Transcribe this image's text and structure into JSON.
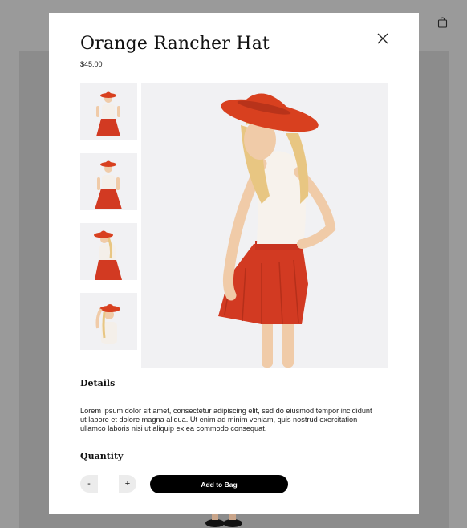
{
  "product": {
    "title": "Orange Rancher Hat",
    "price": "$45.00"
  },
  "icons": {
    "close": "close-icon",
    "bag": "shopping-bag-icon"
  },
  "gallery": {
    "thumbnails": [
      {
        "pose": "standing-hand-on-hip"
      },
      {
        "pose": "standing-front"
      },
      {
        "pose": "looking-back"
      },
      {
        "pose": "hand-on-hat"
      }
    ],
    "main_pose": "looking-back-over-shoulder"
  },
  "details": {
    "heading": "Details",
    "text": "Lorem ipsum dolor sit amet, consectetur adipiscing elit, sed do eiusmod tempor incididunt ut labore et dolore magna aliqua. Ut enim ad minim veniam, quis nostrud exercitation ullamco laboris nisi ut aliquip ex ea commodo consequat."
  },
  "quantity": {
    "heading": "Quantity",
    "decrement_label": "-",
    "increment_label": "+",
    "value": ""
  },
  "actions": {
    "add_to_bag_label": "Add to Bag"
  },
  "colors": {
    "hat": "#d8401f",
    "skirt": "#d23a22",
    "button": "#000000",
    "backdrop": "#9a9a9a"
  }
}
